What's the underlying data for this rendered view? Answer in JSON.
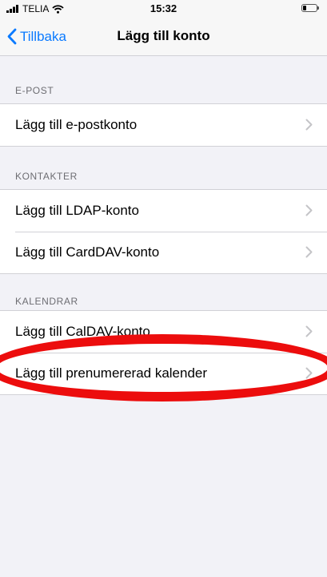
{
  "status_bar": {
    "carrier": "TELIA",
    "time": "15:32",
    "icons": [
      "signal-icon",
      "wifi-icon",
      "battery-icon"
    ]
  },
  "nav": {
    "back_label": "Tillbaka",
    "title": "Lägg till konto",
    "accent_color": "#0a7aff"
  },
  "sections": [
    {
      "header": "E-POST",
      "items": [
        {
          "label": "Lägg till e-postkonto"
        }
      ]
    },
    {
      "header": "KONTAKTER",
      "items": [
        {
          "label": "Lägg till LDAP-konto"
        },
        {
          "label": "Lägg till CardDAV-konto"
        }
      ]
    },
    {
      "header": "KALENDRAR",
      "items": [
        {
          "label": "Lägg till CalDAV-konto"
        },
        {
          "label": "Lägg till prenumererad kalender"
        }
      ]
    }
  ],
  "annotation": {
    "color": "#ec0d0d"
  }
}
